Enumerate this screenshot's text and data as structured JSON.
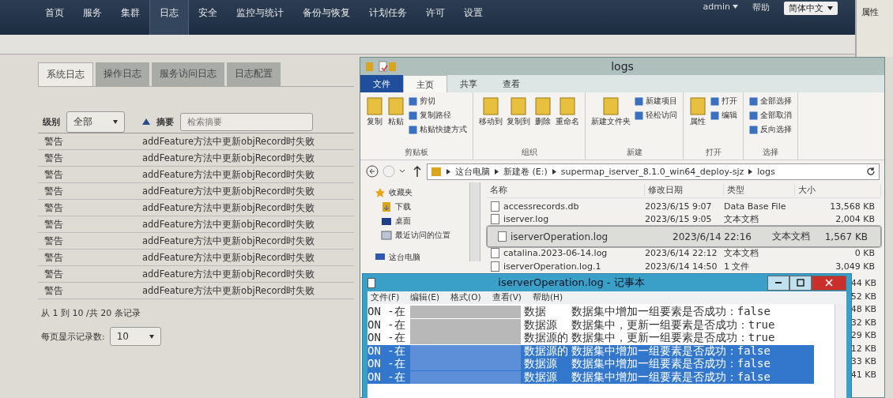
{
  "nav": {
    "items": [
      {
        "label": "首页",
        "selected": false
      },
      {
        "label": "服务",
        "selected": false
      },
      {
        "label": "集群",
        "selected": false
      },
      {
        "label": "日志",
        "selected": true
      },
      {
        "label": "安全",
        "selected": false
      },
      {
        "label": "监控与统计",
        "selected": false
      },
      {
        "label": "备份与恢复",
        "selected": false
      },
      {
        "label": "计划任务",
        "selected": false
      },
      {
        "label": "许可",
        "selected": false
      },
      {
        "label": "设置",
        "selected": false
      }
    ],
    "user": "admin",
    "help": "帮助",
    "language": "简体中文"
  },
  "side_panel": {
    "title": "属性"
  },
  "log_tabs": [
    {
      "label": "系统日志",
      "selected": true
    },
    {
      "label": "操作日志",
      "selected": false
    },
    {
      "label": "服务访问日志",
      "selected": false
    },
    {
      "label": "日志配置",
      "selected": false
    }
  ],
  "filter": {
    "level_label": "级别",
    "level_value": "全部",
    "summary_label": "摘要",
    "summary_placeholder": "检索摘要"
  },
  "log_rows": [
    {
      "level": "警告",
      "summary": "addFeature方法中更新objRecord时失败"
    },
    {
      "level": "警告",
      "summary": "addFeature方法中更新objRecord时失败"
    },
    {
      "level": "警告",
      "summary": "addFeature方法中更新objRecord时失败"
    },
    {
      "level": "警告",
      "summary": "addFeature方法中更新objRecord时失败"
    },
    {
      "level": "警告",
      "summary": "addFeature方法中更新objRecord时失败"
    },
    {
      "level": "警告",
      "summary": "addFeature方法中更新objRecord时失败"
    },
    {
      "level": "警告",
      "summary": "addFeature方法中更新objRecord时失败"
    },
    {
      "level": "警告",
      "summary": "addFeature方法中更新objRecord时失败"
    },
    {
      "level": "警告",
      "summary": "addFeature方法中更新objRecord时失败"
    },
    {
      "level": "警告",
      "summary": "addFeature方法中更新objRecord时失败"
    }
  ],
  "pagination": {
    "summary": "从 1 到 10 /共 20 条记录",
    "page_size_label": "每页显示记录数:",
    "page_size": "10"
  },
  "explorer": {
    "title": "logs",
    "ribbon_tabs": [
      {
        "label": "文件",
        "kind": "file",
        "selected": false
      },
      {
        "label": "主页",
        "kind": "tab",
        "selected": true
      },
      {
        "label": "共享",
        "kind": "tab",
        "selected": false
      },
      {
        "label": "查看",
        "kind": "tab",
        "selected": false
      }
    ],
    "groups": [
      {
        "name": "剪贴板",
        "large": [
          "复制",
          "粘贴"
        ],
        "small": [
          "剪切",
          "复制路径",
          "粘贴快捷方式"
        ]
      },
      {
        "name": "组织",
        "large": [
          "移动到",
          "复制到",
          "删除",
          "重命名"
        ]
      },
      {
        "name": "新建",
        "large": [
          "新建文件夹"
        ],
        "small": [
          "新建项目",
          "轻松访问"
        ]
      },
      {
        "name": "打开",
        "large": [
          "属性"
        ],
        "small": [
          "打开",
          "编辑"
        ]
      },
      {
        "name": "选择",
        "small": [
          "全部选择",
          "全部取消",
          "反向选择"
        ]
      }
    ],
    "path": [
      "这台电脑",
      "新建卷 (E:)",
      "supermap_iserver_8.1.0_win64_deploy-sjz",
      "logs"
    ],
    "nav_pane": [
      {
        "label": "收藏夹",
        "kind": "star"
      },
      {
        "label": "下载",
        "kind": "download"
      },
      {
        "label": "桌面",
        "kind": "desktop"
      },
      {
        "label": "最近访问的位置",
        "kind": "recent"
      },
      {
        "label": "这台电脑",
        "kind": "pc"
      }
    ],
    "columns": [
      "名称",
      "修改日期",
      "类型",
      "大小"
    ],
    "files": [
      {
        "name": "accessrecords.db",
        "date": "2023/6/15 9:07",
        "type": "Data Base File",
        "size": "13,568 KB",
        "selected": false
      },
      {
        "name": "iserver.log",
        "date": "2023/6/15 9:05",
        "type": "文本文档",
        "size": "2,004 KB",
        "selected": false
      },
      {
        "name": "iserverOperation.log",
        "date": "2023/6/14 22:16",
        "type": "文本文档",
        "size": "1,567 KB",
        "selected": true
      },
      {
        "name": "catalina.2023-06-14.log",
        "date": "2023/6/14 22:12",
        "type": "文本文档",
        "size": "0 KB",
        "selected": false
      },
      {
        "name": "iserverOperation.log.1",
        "date": "2023/6/14 14:50",
        "type": "1 文件",
        "size": "3,049 KB",
        "selected": false
      }
    ],
    "hidden_row_sizes": [
      "44 KB",
      "52 KB",
      "48 KB",
      "32 KB",
      "29 KB",
      "12 KB",
      "33 KB",
      "41 KB"
    ]
  },
  "notepad": {
    "title": "iserverOperation.log - 记事本",
    "menu": [
      "文件(F)",
      "编辑(E)",
      "格式(O)",
      "查看(V)",
      "帮助(H)"
    ],
    "lines": [
      {
        "prefix": "ON -在",
        "middle": "数据",
        "text": "数据集中增加一组要素是否成功：false",
        "selected": false
      },
      {
        "prefix": "ON -在",
        "middle": "数据源",
        "text": "数据集中，更新一组要素是否成功：true",
        "selected": false
      },
      {
        "prefix": "ON -在",
        "middle": "数据源的",
        "text": "数据集中，更新一组要素是否成功：true",
        "selected": false
      },
      {
        "prefix": "ON -在",
        "middle": "数据源的",
        "text": "数据集中增加一组要素是否成功：false",
        "selected": true
      },
      {
        "prefix": "ON -在",
        "middle": "数据源",
        "text": "数据集中增加一组要素是否成功：false",
        "selected": true
      },
      {
        "prefix": "ON -在",
        "middle": "数据源",
        "text": "数据集中增加一组要素是否成功：false",
        "selected": true
      }
    ]
  }
}
